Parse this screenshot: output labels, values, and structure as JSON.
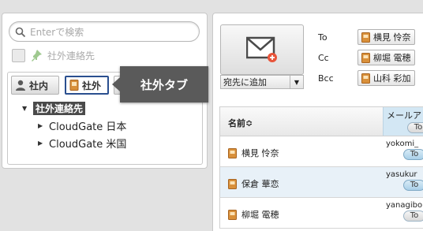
{
  "search": {
    "placeholder": "Enterで検索"
  },
  "external_filter": {
    "label": "社外連絡先"
  },
  "tabs": [
    {
      "label": "社内"
    },
    {
      "label": "社外"
    }
  ],
  "tooltip": "社外タブ",
  "tree": {
    "root": "社外連絡先",
    "children": [
      "CloudGate 日本",
      "CloudGate 米国"
    ]
  },
  "compose": {
    "add_select": "宛先に追加"
  },
  "recipients": {
    "to": {
      "label": "To",
      "name": "横見 怜奈"
    },
    "cc": {
      "label": "Cc",
      "name": "柳堀 電穂"
    },
    "bcc": {
      "label": "Bcc",
      "name": "山科 彩加"
    }
  },
  "table": {
    "col_name": "名前≎",
    "col_mail": "メールア",
    "to_label": "To",
    "rows": [
      {
        "name": "横見 怜奈",
        "mail": "yokomi_"
      },
      {
        "name": "保倉 華恋",
        "mail": "yasukur"
      },
      {
        "name": "柳堀 電穂",
        "mail": "yanagibo"
      }
    ]
  },
  "colors": {
    "accent": "#2a4f8f",
    "tooltip_bg": "#5a5a5a",
    "selected_column": "#d3e7f4",
    "badge": "#e8543a"
  },
  "icons": [
    "search-icon",
    "pin-icon",
    "person-icon",
    "address-book-icon",
    "star-icon",
    "envelope-icon",
    "plus-badge-icon",
    "triangle-down-icon",
    "triangle-right-icon"
  ]
}
